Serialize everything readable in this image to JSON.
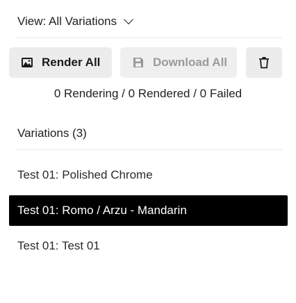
{
  "view": {
    "label": "View: All Variations",
    "icon": "chevron-down-icon"
  },
  "toolbar": {
    "render_label": "Render All",
    "render_icon": "image-icon",
    "download_label": "Download All",
    "download_icon": "save-icon",
    "download_disabled": true,
    "delete_icon": "trash-icon"
  },
  "status": {
    "text": "0 Rendering / 0 Rendered / 0 Failed"
  },
  "variations": {
    "heading": "Variations (3)",
    "items": [
      {
        "label": "Test 01: Polished Chrome",
        "selected": false
      },
      {
        "label": "Test 01: Romo / Arzu - Mandarin",
        "selected": true
      },
      {
        "label": "Test 01: Test 01",
        "selected": false
      }
    ]
  },
  "colors": {
    "selected_bg": "#000000",
    "button_bg": "#ececec",
    "disabled_text": "#9a9a9a"
  }
}
